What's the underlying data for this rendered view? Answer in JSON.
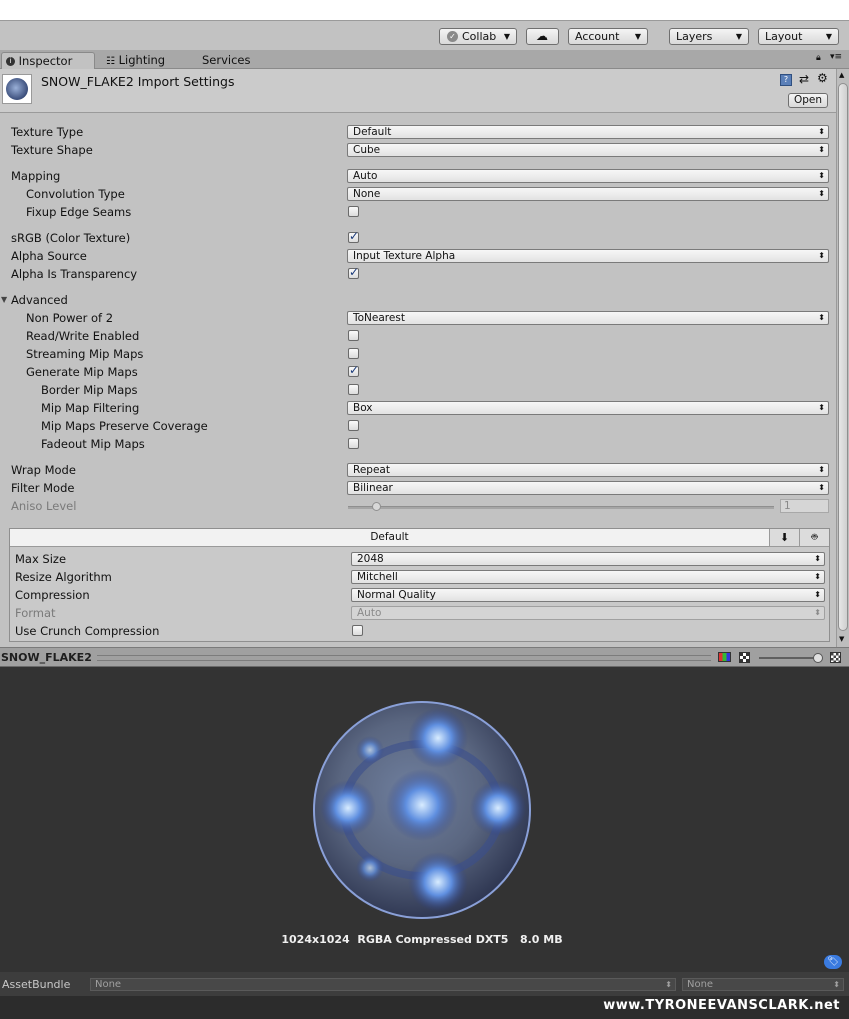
{
  "toolbar": {
    "collab": "Collab",
    "account": "Account",
    "layers": "Layers",
    "layout": "Layout"
  },
  "tabs": [
    {
      "label": "Inspector",
      "active": true
    },
    {
      "label": "Lighting",
      "active": false
    },
    {
      "label": "Services",
      "active": false
    }
  ],
  "header": {
    "title": "SNOW_FLAKE2 Import Settings",
    "open_label": "Open"
  },
  "settings": {
    "texture_type": {
      "label": "Texture Type",
      "value": "Default"
    },
    "texture_shape": {
      "label": "Texture Shape",
      "value": "Cube"
    },
    "mapping": {
      "label": "Mapping",
      "value": "Auto"
    },
    "convolution_type": {
      "label": "Convolution Type",
      "value": "None"
    },
    "fixup_edge_seams": {
      "label": "Fixup Edge Seams",
      "checked": false
    },
    "srgb": {
      "label": "sRGB (Color Texture)",
      "checked": true
    },
    "alpha_source": {
      "label": "Alpha Source",
      "value": "Input Texture Alpha"
    },
    "alpha_is_transparency": {
      "label": "Alpha Is Transparency",
      "checked": true
    },
    "advanced": {
      "label": "Advanced"
    },
    "non_power_of_2": {
      "label": "Non Power of 2",
      "value": "ToNearest"
    },
    "read_write": {
      "label": "Read/Write Enabled",
      "checked": false
    },
    "streaming_mip": {
      "label": "Streaming Mip Maps",
      "checked": false
    },
    "generate_mip": {
      "label": "Generate Mip Maps",
      "checked": true
    },
    "border_mip": {
      "label": "Border Mip Maps",
      "checked": false
    },
    "mip_filtering": {
      "label": "Mip Map Filtering",
      "value": "Box"
    },
    "mip_preserve": {
      "label": "Mip Maps Preserve Coverage",
      "checked": false
    },
    "fadeout_mip": {
      "label": "Fadeout Mip Maps",
      "checked": false
    },
    "wrap_mode": {
      "label": "Wrap Mode",
      "value": "Repeat"
    },
    "filter_mode": {
      "label": "Filter Mode",
      "value": "Bilinear"
    },
    "aniso_level": {
      "label": "Aniso Level",
      "value": "1",
      "level": 1
    }
  },
  "platform": {
    "header": "Default",
    "max_size": {
      "label": "Max Size",
      "value": "2048"
    },
    "resize_algorithm": {
      "label": "Resize Algorithm",
      "value": "Mitchell"
    },
    "compression": {
      "label": "Compression",
      "value": "Normal Quality"
    },
    "format": {
      "label": "Format",
      "value": "Auto"
    },
    "crunch": {
      "label": "Use Crunch Compression",
      "checked": false
    }
  },
  "preview": {
    "title": "SNOW_FLAKE2",
    "info": "1024x1024  RGBA Compressed DXT5   8.0 MB"
  },
  "assetbundle": {
    "label": "AssetBundle",
    "name_value": "None",
    "variant_value": "None"
  },
  "watermark": "www.TYRONEEVANSCLARK.net"
}
